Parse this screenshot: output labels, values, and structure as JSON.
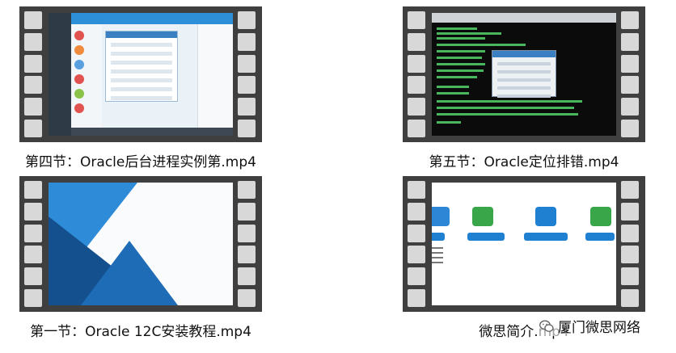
{
  "videos": [
    {
      "caption": "第四节：Oracle后台进程实例第.mp4"
    },
    {
      "caption": "第五节：Oracle定位排错.mp4"
    },
    {
      "caption": "第一节：Oracle 12C安装教程.mp4"
    },
    {
      "caption": "微思简介.mp4"
    }
  ],
  "watermark": {
    "text": "厦门微思网络",
    "icon": "wechat-icon"
  },
  "colors": {
    "film": "#3f3f3f",
    "film_hole": "#d8d8d8",
    "accent_blue": "#2e8bd8",
    "terminal_green": "#55d36c"
  }
}
